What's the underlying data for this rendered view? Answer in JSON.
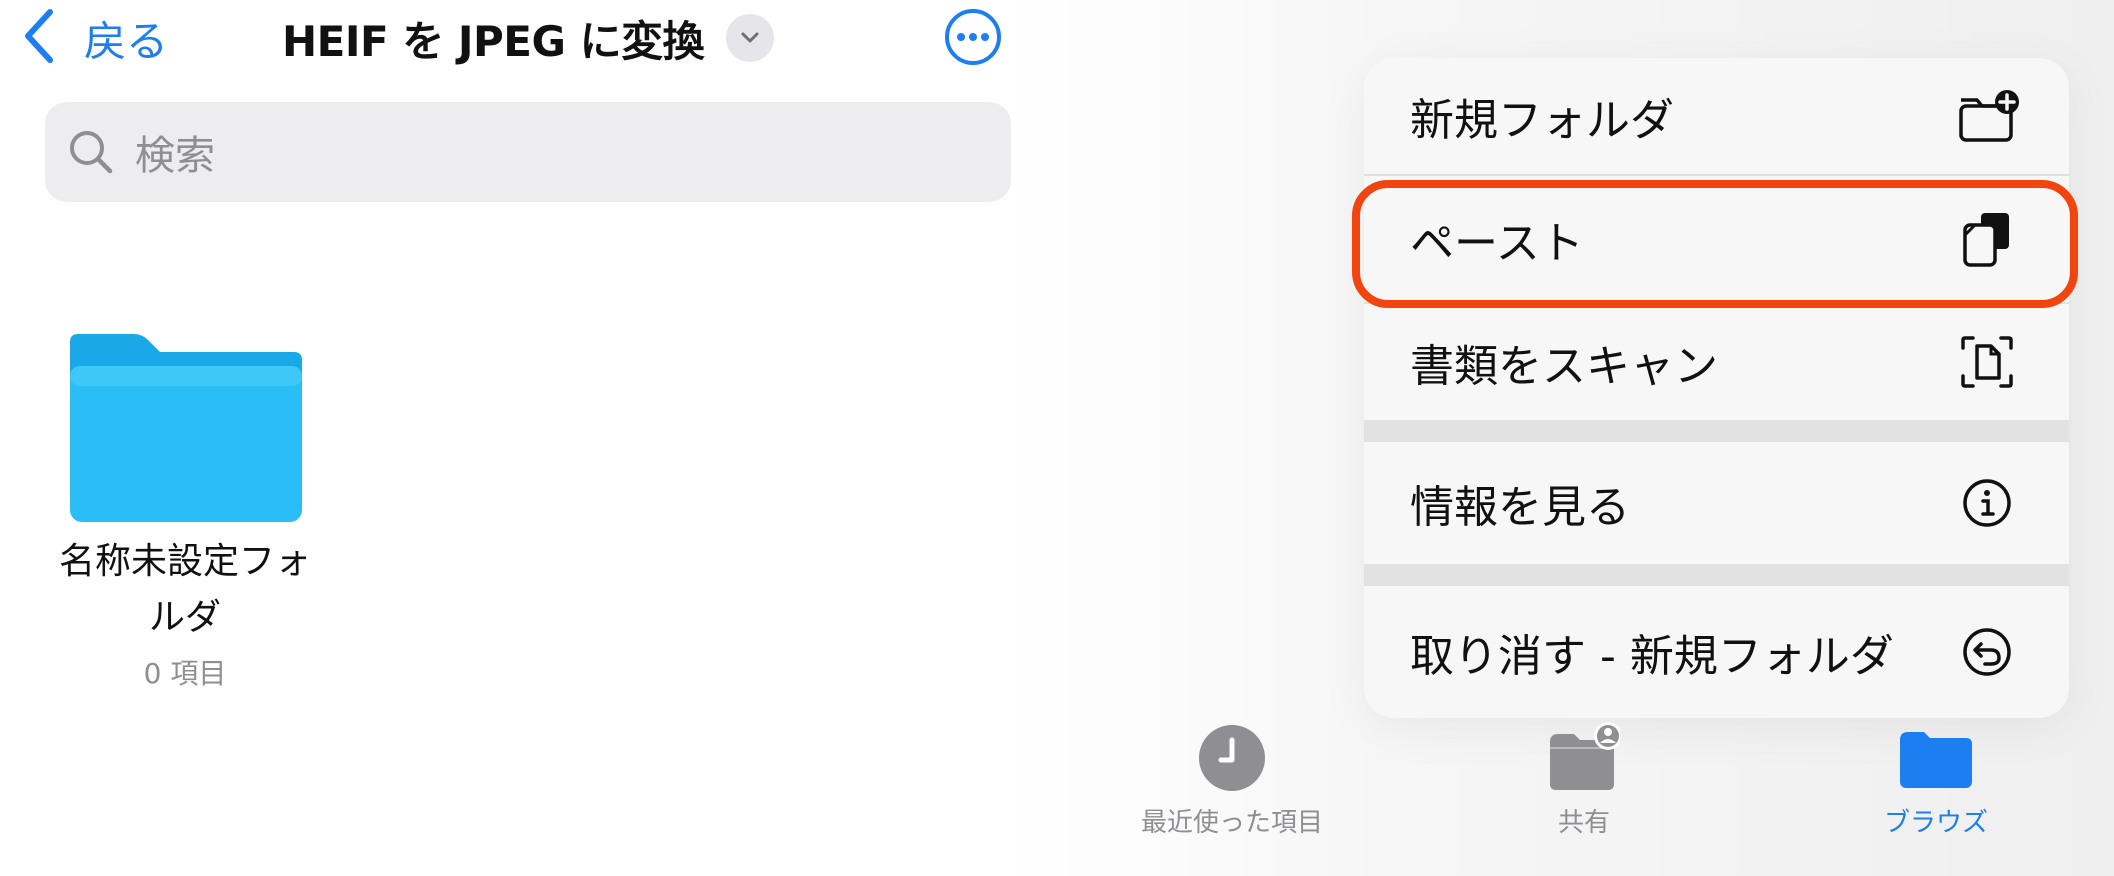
{
  "header": {
    "back_label": "戻る",
    "title": "HEIF を JPEG に変換"
  },
  "search": {
    "placeholder": "検索"
  },
  "folder": {
    "name_line1": "名称未設定フォ",
    "name_line2": "ルダ",
    "item_count": "0 項目"
  },
  "menu": {
    "items": [
      {
        "label": "新規フォルダ",
        "icon": "new-folder-icon"
      },
      {
        "label": "ペースト",
        "icon": "paste-icon",
        "highlighted": true
      },
      {
        "label": "書類をスキャン",
        "icon": "scan-document-icon"
      },
      {
        "label": "情報を見る",
        "icon": "info-icon"
      },
      {
        "label": "取り消す - 新規フォルダ",
        "icon": "undo-icon"
      }
    ]
  },
  "tabs": [
    {
      "label": "最近使った項目",
      "icon": "clock-icon",
      "active": false
    },
    {
      "label": "共有",
      "icon": "shared-folder-icon",
      "active": false
    },
    {
      "label": "ブラウズ",
      "icon": "folder-icon",
      "active": true
    }
  ],
  "colors": {
    "accent": "#1c7ef0",
    "highlight": "#f2440f",
    "folder": "#2bbdf5",
    "inactive_tab": "#8e8e93",
    "active_tab": "#1c7ef0"
  }
}
